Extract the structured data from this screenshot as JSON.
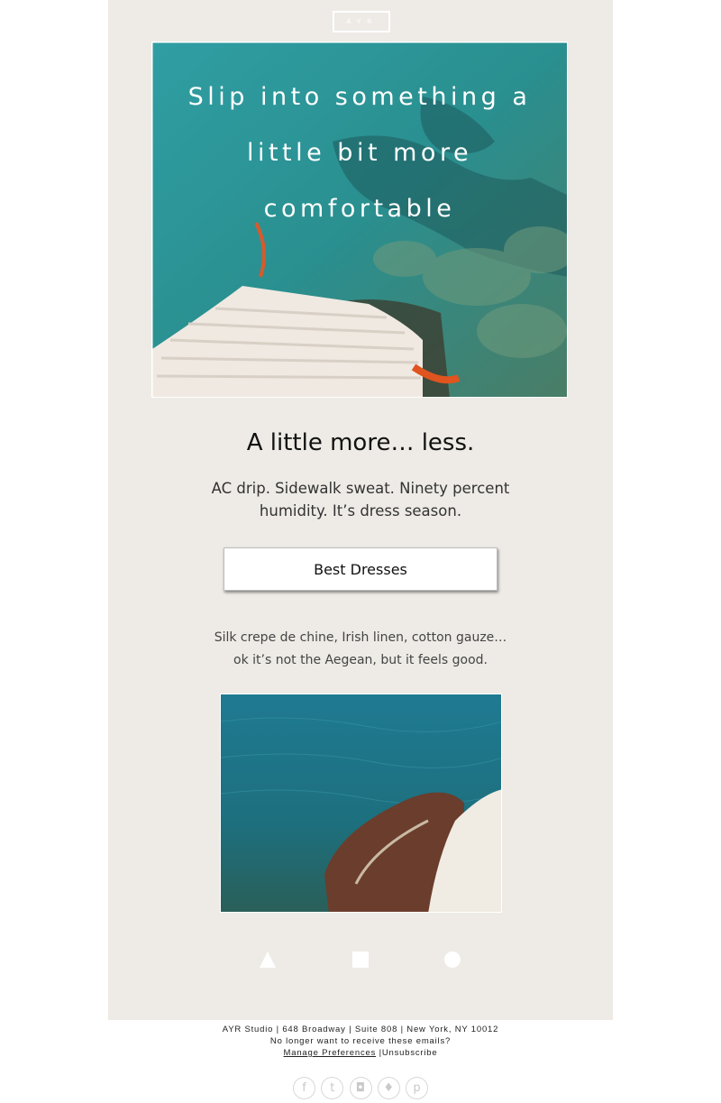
{
  "brand": {
    "logo_text": "AYR"
  },
  "hero": {
    "heading": "Slip into something a little bit more comfortable"
  },
  "headline": "A little more… less.",
  "intro": {
    "line1": "AC drip. Sidewalk sweat. Ninety percent",
    "line2": "humidity. It’s dress season."
  },
  "cta": {
    "label": "Best Dresses"
  },
  "body2": {
    "line1": "Silk crepe de chine, Irish linen, cotton gauze…",
    "line2": "ok it’s not the Aegean, but it feels good."
  },
  "shapes": [
    "triangle-icon",
    "square-icon",
    "circle-icon"
  ],
  "footer": {
    "address": "AYR Studio | 648 Broadway | Suite 808 | New York, NY 10012",
    "optout": "No longer want to receive these emails?",
    "manage": "Manage Preferences",
    "separator": "|",
    "unsubscribe": "Unsubscribe"
  },
  "social": [
    {
      "icon": "facebook-icon",
      "glyph": "f"
    },
    {
      "icon": "tumblr-icon",
      "glyph": "t"
    },
    {
      "icon": "instagram-icon",
      "glyph": "◘"
    },
    {
      "icon": "twitter-icon",
      "glyph": "♦"
    },
    {
      "icon": "pinterest-icon",
      "glyph": "p"
    }
  ],
  "colors": {
    "card_bg": "#eeebe6",
    "water": "#2a9b9f",
    "text": "#111111"
  }
}
